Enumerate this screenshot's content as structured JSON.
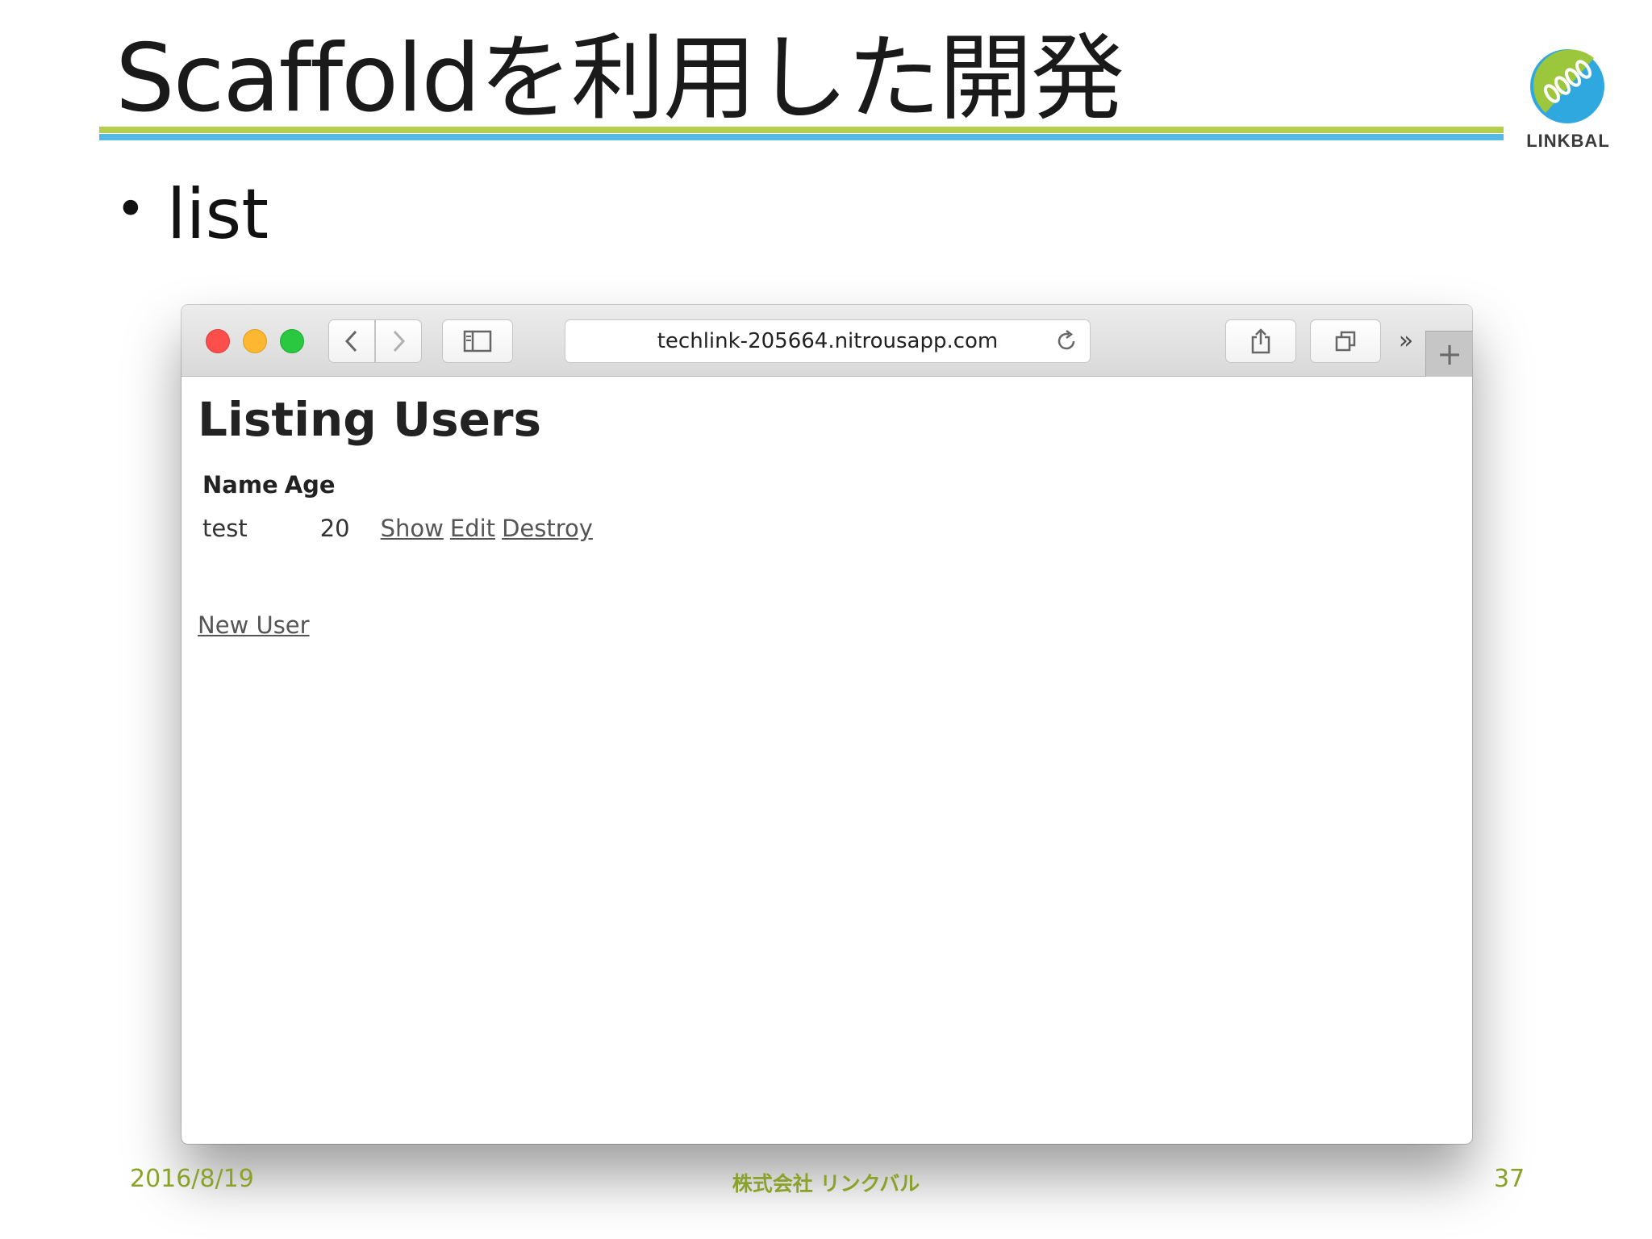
{
  "slide": {
    "title": "Scaffoldを利用した開発",
    "bullet": "list",
    "logo_text": "LINKBAL",
    "footer": {
      "date": "2016/8/19",
      "company": "株式会社 リンクバル",
      "page_number": "37"
    },
    "colors": {
      "rule_green": "#b5cf4a",
      "rule_blue": "#55b9e6",
      "footer_text": "#8aa12a"
    }
  },
  "browser": {
    "url": "techlink-205664.nitrousapp.com",
    "buttons": {
      "back": "‹",
      "forward": "›",
      "more": "»",
      "new_tab": "+"
    },
    "icons": [
      "sidebar-icon",
      "reload-icon",
      "share-icon",
      "tabs-icon"
    ]
  },
  "page": {
    "heading": "Listing Users",
    "table": {
      "headers": [
        "Name",
        "Age"
      ],
      "rows": [
        {
          "name": "test",
          "age": "20",
          "links": [
            "Show",
            "Edit",
            "Destroy"
          ]
        }
      ]
    },
    "new_user_link": "New User"
  }
}
